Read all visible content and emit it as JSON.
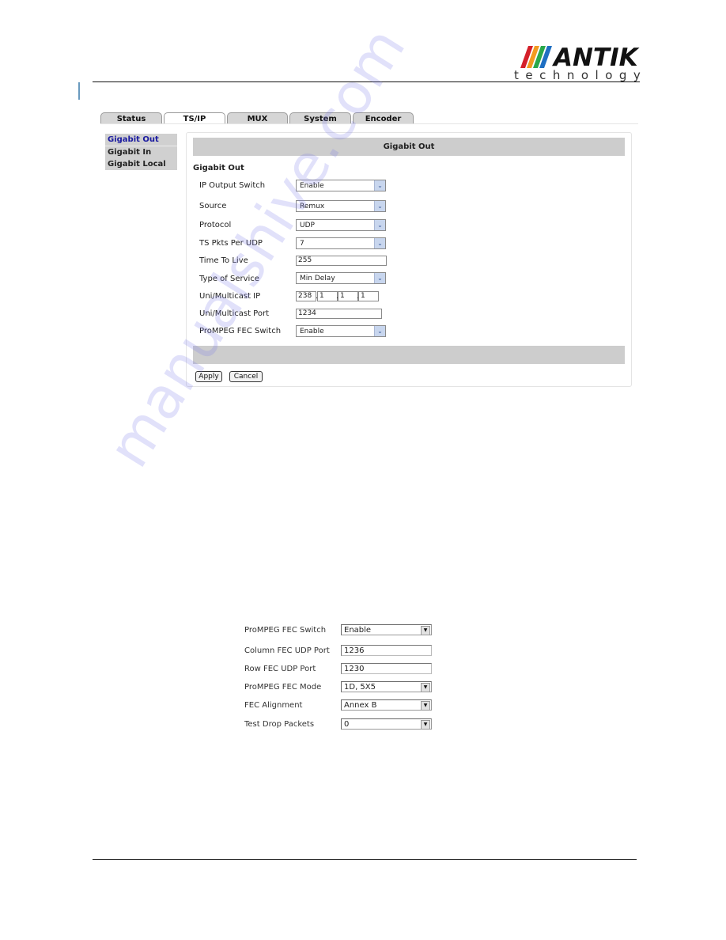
{
  "header": {
    "brand": "ANTIK",
    "brand_sub": "technology",
    "logo_colors": [
      "#d4202a",
      "#f29a1f",
      "#2aa84a",
      "#1f6fc2"
    ]
  },
  "tabs": [
    {
      "label": "Status",
      "active": false
    },
    {
      "label": "TS/IP",
      "active": true
    },
    {
      "label": "MUX",
      "active": false
    },
    {
      "label": "System",
      "active": false
    },
    {
      "label": "Encoder",
      "active": false
    }
  ],
  "leftnav": [
    {
      "label": "Gigabit Out",
      "active": true
    },
    {
      "label": "Gigabit In",
      "active": false
    },
    {
      "label": "Gigabit Local",
      "active": false
    }
  ],
  "panel": {
    "heading": "Gigabit Out",
    "section_title": "Gigabit Out",
    "fields": {
      "ip_output_switch": {
        "label": "IP Output Switch",
        "value": "Enable"
      },
      "source": {
        "label": "Source",
        "value": "Remux"
      },
      "protocol": {
        "label": "Protocol",
        "value": "UDP"
      },
      "ts_pkts_per_udp": {
        "label": "TS Pkts Per UDP",
        "value": "7"
      },
      "time_to_live": {
        "label": "Time To Live",
        "value": "255"
      },
      "type_of_service": {
        "label": "Type of Service",
        "value": "Min Delay"
      },
      "multicast_ip": {
        "label": "Uni/Multicast IP",
        "octets": [
          "238",
          "1",
          "1",
          "1"
        ]
      },
      "multicast_port": {
        "label": "Uni/Multicast Port",
        "value": "1234"
      },
      "prompeg_fec_switch": {
        "label": "ProMPEG FEC Switch",
        "value": "Enable"
      }
    },
    "apply_label": "Apply",
    "cancel_label": "Cancel"
  },
  "fec_form": {
    "fields": {
      "prompeg_fec_switch": {
        "label": "ProMPEG FEC Switch",
        "value": "Enable"
      },
      "column_fec_udp_port": {
        "label": "Column FEC UDP Port",
        "value": "1236"
      },
      "row_fec_udp_port": {
        "label": "Row FEC UDP Port",
        "value": "1230"
      },
      "prompeg_fec_mode": {
        "label": "ProMPEG FEC Mode",
        "value": "1D, 5X5"
      },
      "fec_alignment": {
        "label": "FEC Alignment",
        "value": "Annex B"
      },
      "test_drop_packets": {
        "label": "Test Drop Packets",
        "value": "0"
      }
    }
  },
  "watermark": "manualshive.com"
}
